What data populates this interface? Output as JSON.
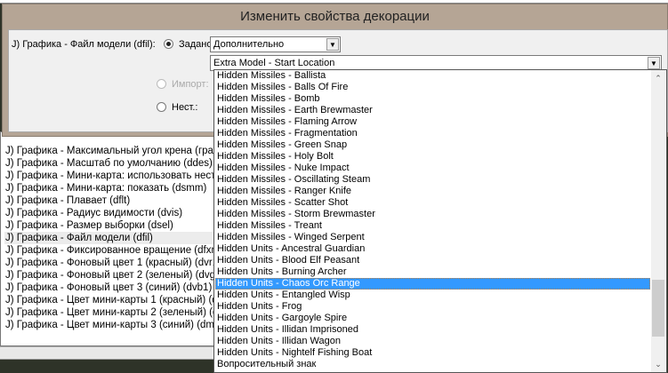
{
  "dialog": {
    "title": "Изменить свойства декорации",
    "field_label": "J) Графика - Файл модели (dfil):",
    "radio_set_label": "Задано:",
    "radio_import_label": "Импорт:",
    "radio_custom_label": "Нест.:",
    "category_value": "Дополнительно",
    "model_value": "Extra Model - Start Location"
  },
  "dropdown": {
    "selected_index": 18,
    "items": [
      "Hidden Missiles - Ballista",
      "Hidden Missiles - Balls Of Fire",
      "Hidden Missiles - Bomb",
      "Hidden Missiles - Earth Brewmaster",
      "Hidden Missiles - Flaming Arrow",
      "Hidden Missiles - Fragmentation",
      "Hidden Missiles - Green Snap",
      "Hidden Missiles - Holy Bolt",
      "Hidden Missiles - Nuke Impact",
      "Hidden Missiles - Oscillating Steam",
      "Hidden Missiles - Ranger Knife",
      "Hidden Missiles - Scatter Shot",
      "Hidden Missiles - Storm Brewmaster",
      "Hidden Missiles - Treant",
      "Hidden Missiles - Winged Serpent",
      "Hidden Units - Ancestral Guardian",
      "Hidden Units - Blood Elf Peasant",
      "Hidden Units - Burning Archer",
      "Hidden Units - Chaos Orc Range",
      "Hidden Units - Entangled Wisp",
      "Hidden Units - Frog",
      "Hidden Units - Gargoyle Spire",
      "Hidden Units - Illidan Imprisoned",
      "Hidden Units - Illidan Wagon",
      "Hidden Units - Nightelf Fishing Boat",
      "Вопросительный знак"
    ]
  },
  "properties": {
    "selected_index": 7,
    "items": [
      "J) Графика - Максимальный угол крена (град.)",
      "J) Графика - Масштаб по умолчанию (ddes)",
      "J) Графика - Мини-карта: использовать нестан",
      "J) Графика - Мини-карта: показать (dsmm)",
      "J) Графика - Плавает (dflt)",
      "J) Графика - Радиус видимости (dvis)",
      "J) Графика - Размер выборки (dsel)",
      "J) Графика - Файл модели (dfil)",
      "J) Графика - Фиксированное вращение (dfxr)",
      "J) Графика - Фоновый цвет 1 (красный) (dvr1)",
      "J) Графика - Фоновый цвет 2 (зеленый) (dvg1)",
      "J) Графика - Фоновый цвет 3 (синий) (dvb1)",
      "J) Графика - Цвет мини-карты 1 (красный) (dmr",
      "J) Графика - Цвет мини-карты 2 (зеленый) (dmr",
      "J) Графика - Цвет мини-карты 3 (синий) (dmmb)"
    ]
  },
  "colors": {
    "title_bar": "#b5a595",
    "highlight": "#3399ff"
  }
}
